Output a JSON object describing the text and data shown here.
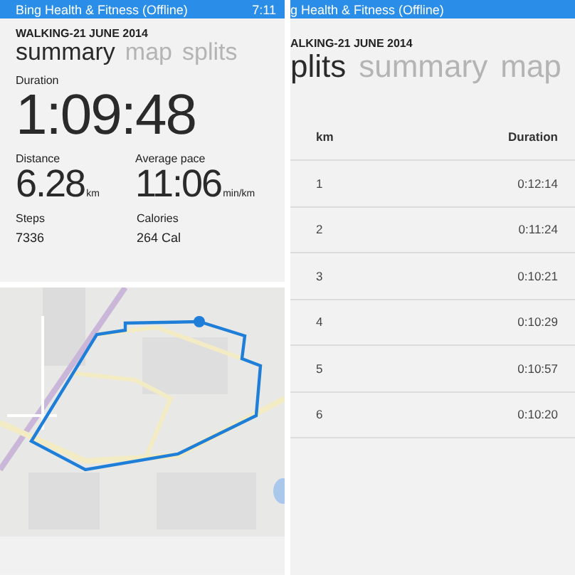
{
  "summary_screen": {
    "status_bar": {
      "title": "Bing Health & Fitness (Offline)",
      "time": "7:11"
    },
    "heading": "WALKING-21 JUNE 2014",
    "tabs": [
      {
        "label": "summary",
        "selected": true
      },
      {
        "label": "map",
        "selected": false
      },
      {
        "label": "splits",
        "selected": false
      }
    ],
    "duration": {
      "label": "Duration",
      "value": "1:09:48"
    },
    "stats": [
      {
        "label": "Distance",
        "value": "6.28",
        "unit": "km"
      },
      {
        "label": "Average pace",
        "value": "11:06",
        "unit": "min/km"
      }
    ],
    "extras": [
      {
        "label": "Steps",
        "value": "7336"
      },
      {
        "label": "Calories",
        "value": "264 Cal"
      }
    ]
  },
  "splits_screen": {
    "status_bar": {
      "title": "g Health & Fitness (Offline)"
    },
    "heading": "ALKING-21 JUNE 2014",
    "tabs": [
      {
        "label": "plits",
        "selected": true
      },
      {
        "label": "summary",
        "selected": false
      },
      {
        "label": "map",
        "selected": false
      }
    ],
    "table": {
      "columns": [
        "km",
        "Duration"
      ],
      "rows": [
        [
          "1",
          "0:12:14"
        ],
        [
          "2",
          "0:11:24"
        ],
        [
          "3",
          "0:10:21"
        ],
        [
          "4",
          "0:10:29"
        ],
        [
          "5",
          "0:10:57"
        ],
        [
          "6",
          "0:10:20"
        ]
      ]
    }
  }
}
